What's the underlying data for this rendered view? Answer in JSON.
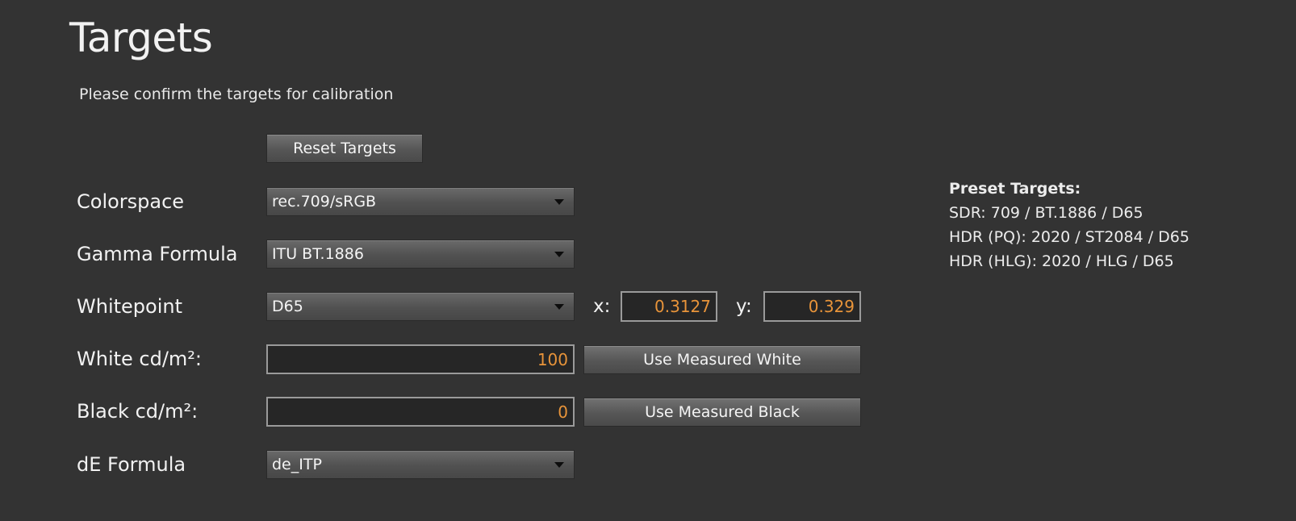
{
  "header": {
    "title": "Targets",
    "subtitle": "Please confirm the targets for calibration"
  },
  "reset_button": "Reset Targets",
  "rows": {
    "colorspace": {
      "label": "Colorspace",
      "value": "rec.709/sRGB"
    },
    "gamma": {
      "label": "Gamma Formula",
      "value": "ITU BT.1886"
    },
    "whitepoint": {
      "label": "Whitepoint",
      "value": "D65",
      "x_label": "x:",
      "x_value": "0.3127",
      "y_label": "y:",
      "y_value": "0.329"
    },
    "white": {
      "label": "White cd/m²:",
      "value": "100",
      "button": "Use Measured White"
    },
    "black": {
      "label": "Black cd/m²:",
      "value": "0",
      "button": "Use Measured Black"
    },
    "de_formula": {
      "label": "dE Formula",
      "value": "de_ITP"
    }
  },
  "presets": {
    "heading": "Preset Targets:",
    "items": [
      "SDR: 709 / BT.1886 / D65",
      "HDR (PQ): 2020 / ST2084 / D65",
      "HDR (HLG): 2020 / HLG / D65"
    ]
  },
  "colors": {
    "background": "#333333",
    "value_accent": "#e8943a",
    "text": "#f2f2f2"
  },
  "icons": {
    "dropdown": "triangle-down-icon"
  }
}
